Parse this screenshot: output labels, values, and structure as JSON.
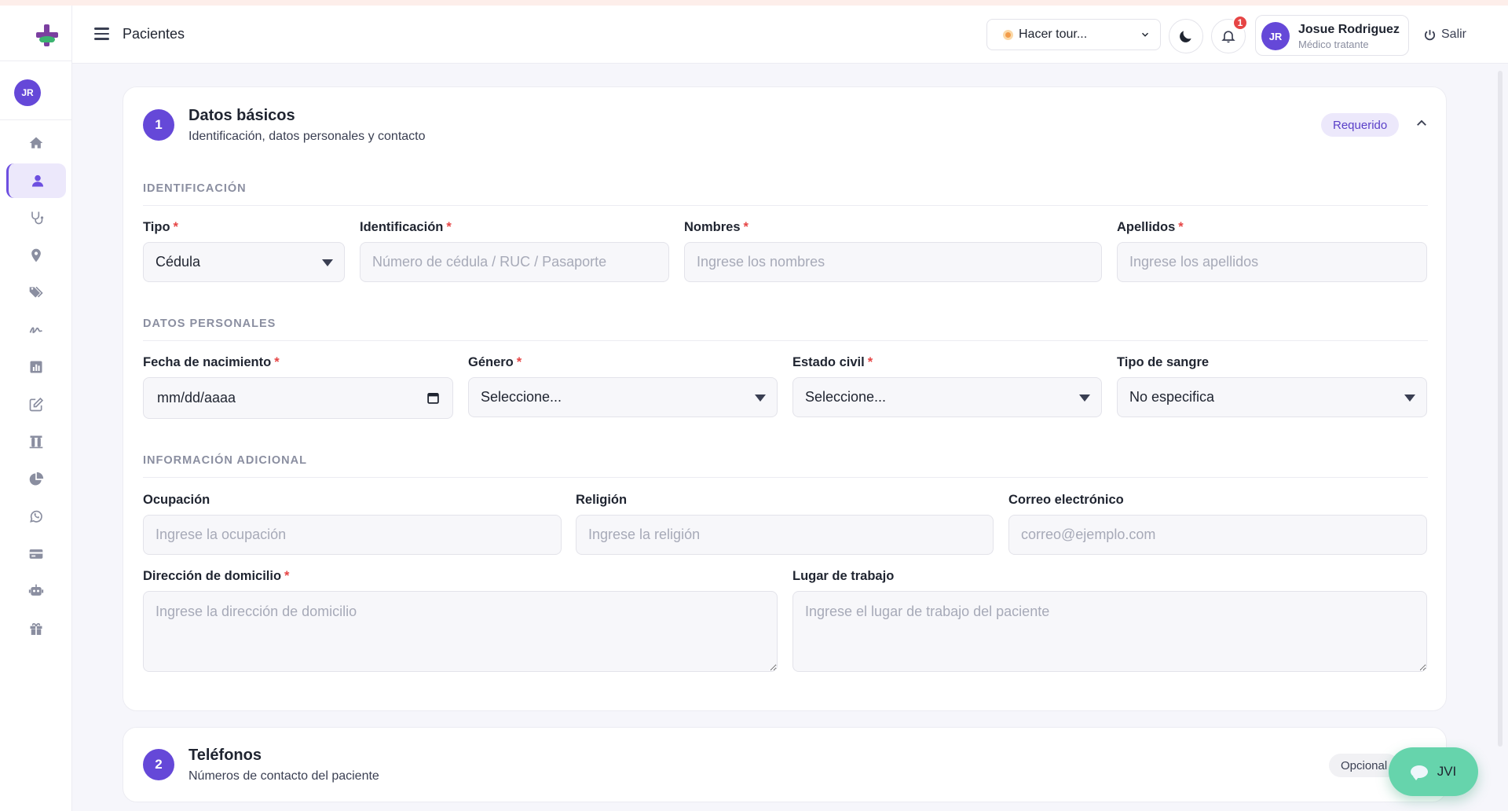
{
  "header": {
    "title": "Pacientes",
    "tour_label": "Hacer tour...",
    "notifications_count": "1",
    "user": {
      "initials": "JR",
      "name": "Josue Rodriguez",
      "role": "Médico tratante"
    },
    "logout_label": "Salir"
  },
  "sidebar": {
    "avatar_initials": "JR",
    "items": [
      {
        "name": "home-icon",
        "active": false
      },
      {
        "name": "user-icon",
        "active": true
      },
      {
        "name": "stethoscope-icon",
        "active": false
      },
      {
        "name": "map-pin-icon",
        "active": false
      },
      {
        "name": "tags-icon",
        "active": false
      },
      {
        "name": "signature-icon",
        "active": false
      },
      {
        "name": "bar-chart-icon",
        "active": false
      },
      {
        "name": "edit-icon",
        "active": false
      },
      {
        "name": "test-tubes-icon",
        "active": false
      },
      {
        "name": "pie-chart-icon",
        "active": false
      },
      {
        "name": "whatsapp-icon",
        "active": false
      },
      {
        "name": "credit-card-icon",
        "active": false
      },
      {
        "name": "robot-icon",
        "active": false
      },
      {
        "name": "gift-icon",
        "active": false
      }
    ]
  },
  "section1": {
    "step": "1",
    "title": "Datos básicos",
    "subtitle": "Identificación, datos personales y contacto",
    "badge": "Requerido",
    "identificacion": {
      "heading": "IDENTIFICACIÓN",
      "tipo": {
        "label": "Tipo",
        "value": "Cédula"
      },
      "identificacion": {
        "label": "Identificación",
        "placeholder": "Número de cédula / RUC / Pasaporte"
      },
      "nombres": {
        "label": "Nombres",
        "placeholder": "Ingrese los nombres"
      },
      "apellidos": {
        "label": "Apellidos",
        "placeholder": "Ingrese los apellidos"
      }
    },
    "personales": {
      "heading": "DATOS PERSONALES",
      "fecha": {
        "label": "Fecha de nacimiento",
        "value": "mm/dd/aaaa"
      },
      "genero": {
        "label": "Género",
        "value": "Seleccione..."
      },
      "estado_civil": {
        "label": "Estado civil",
        "value": "Seleccione..."
      },
      "sangre": {
        "label": "Tipo de sangre",
        "value": "No especifica"
      }
    },
    "adicional": {
      "heading": "INFORMACIÓN ADICIONAL",
      "ocupacion": {
        "label": "Ocupación",
        "placeholder": "Ingrese la ocupación"
      },
      "religion": {
        "label": "Religión",
        "placeholder": "Ingrese la religión"
      },
      "correo": {
        "label": "Correo electrónico",
        "placeholder": "correo@ejemplo.com"
      },
      "direccion": {
        "label": "Dirección de domicilio",
        "placeholder": "Ingrese la dirección de domicilio"
      },
      "trabajo": {
        "label": "Lugar de trabajo",
        "placeholder": "Ingrese el lugar de trabajo del paciente"
      }
    },
    "required_mark": "*"
  },
  "section2": {
    "step": "2",
    "title": "Teléfonos",
    "subtitle": "Números de contacto del paciente",
    "badge": "Opcional"
  },
  "chat": {
    "label": "JVI"
  },
  "colors": {
    "accent": "#6548d8",
    "required": "#e64545",
    "chat": "#66d4ac"
  }
}
